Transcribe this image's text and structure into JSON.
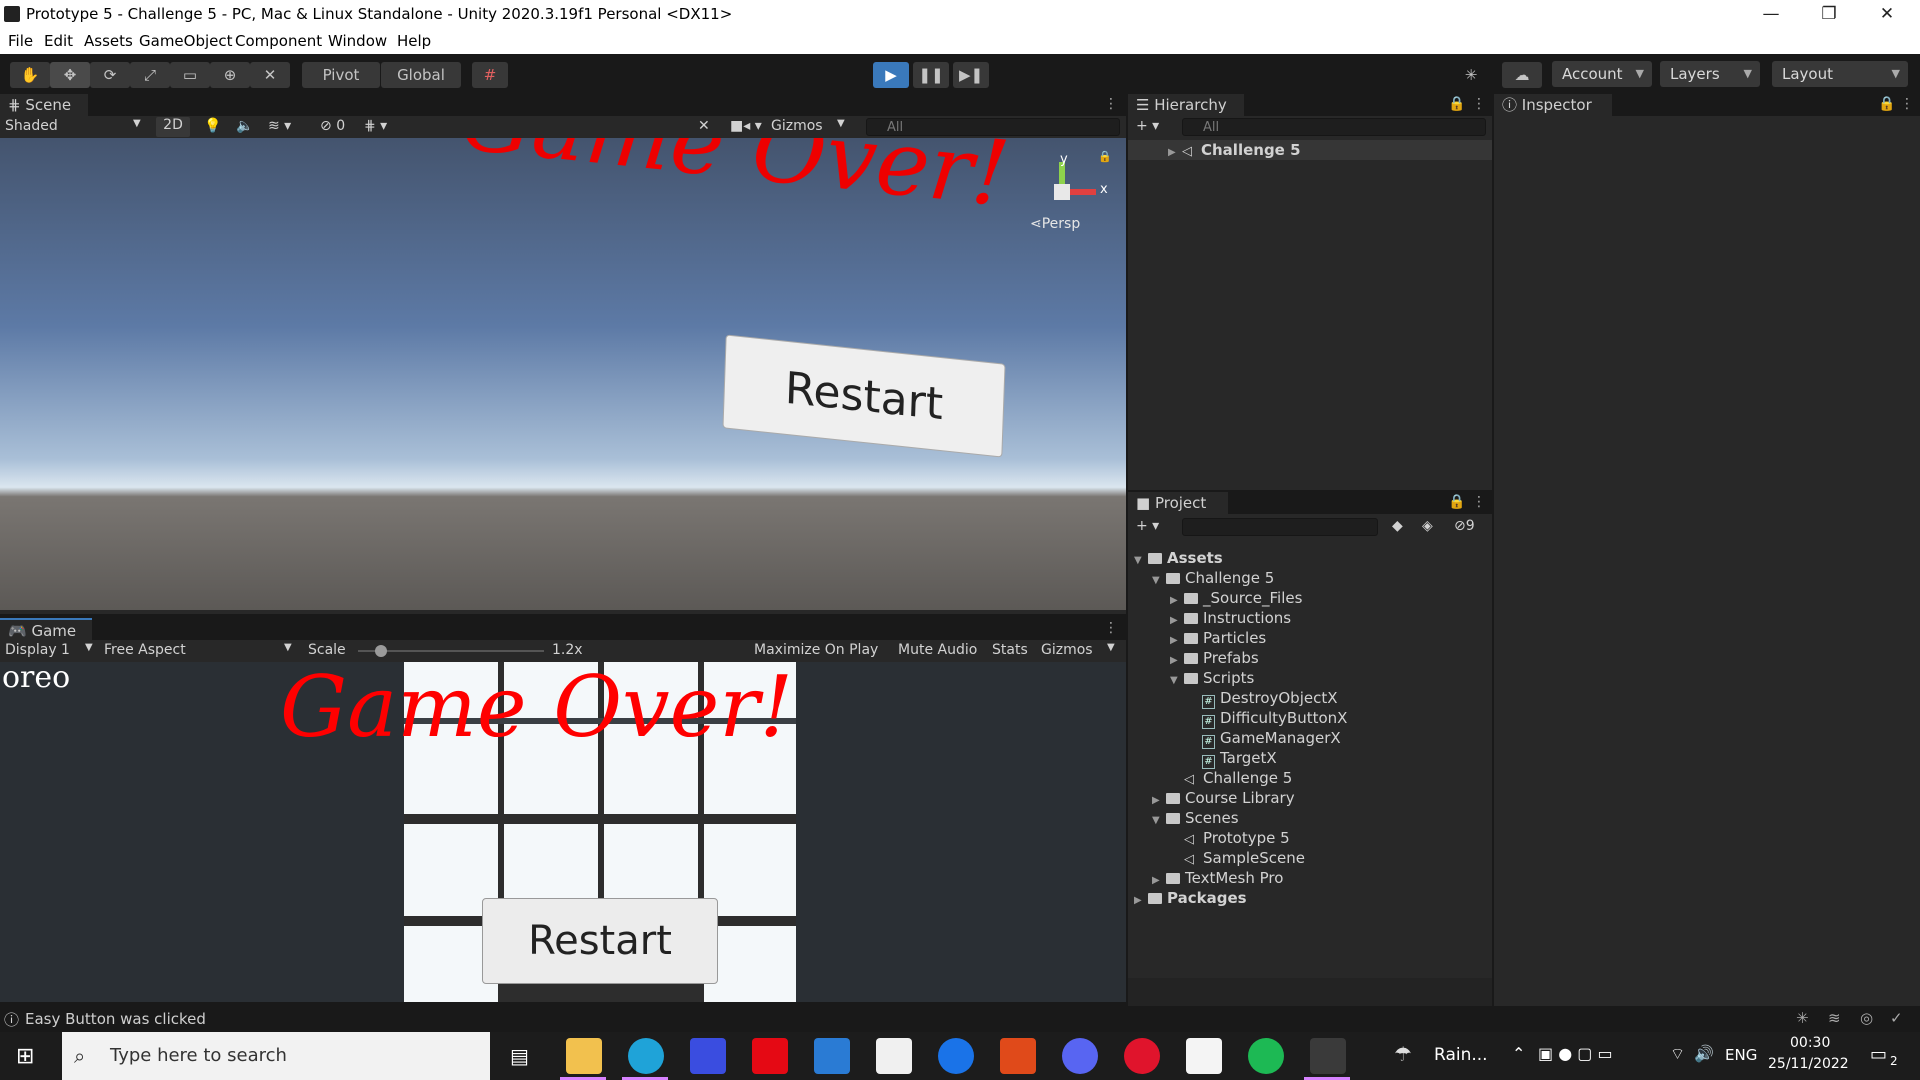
{
  "window": {
    "title": "Prototype 5 - Challenge 5 - PC, Mac & Linux Standalone - Unity 2020.3.19f1 Personal <DX11>",
    "min_glyph": "—",
    "max_glyph": "❐",
    "close_glyph": "✕"
  },
  "menu": [
    "File",
    "Edit",
    "Assets",
    "GameObject",
    "Component",
    "Window",
    "Help"
  ],
  "toolbar": {
    "pivot": "Pivot",
    "global": "Global",
    "account": "Account",
    "layers": "Layers",
    "layout": "Layout"
  },
  "scene": {
    "tab": "Scene",
    "shading": "Shaded",
    "mode_2d": "2D",
    "hidden_count": "0",
    "gizmos": "Gizmos",
    "search_placeholder": "All",
    "persp": "Persp",
    "gizmo_y": "y",
    "gizmo_x": "x",
    "overlay_text": "Game Over!",
    "restart_label": "Restart"
  },
  "game": {
    "tab": "Game",
    "display": "Display 1",
    "aspect": "Free Aspect",
    "scale_label": "Scale",
    "scale_value": "1.2x",
    "scale_level": 0.1,
    "maximize": "Maximize On Play",
    "mute": "Mute Audio",
    "stats": "Stats",
    "gizmos": "Gizmos",
    "score_text": "oreo",
    "game_over_text": "Game Over!",
    "restart_label": "Restart"
  },
  "hierarchy": {
    "tab": "Hierarchy",
    "search_placeholder": "All",
    "root": "Challenge 5"
  },
  "project": {
    "tab": "Project",
    "hidden_count": "9",
    "tree": [
      {
        "label": "Assets",
        "depth": 0,
        "kind": "folder",
        "expanded": true,
        "bold": true
      },
      {
        "label": "Challenge 5",
        "depth": 1,
        "kind": "folder",
        "expanded": true
      },
      {
        "label": "_Source_Files",
        "depth": 2,
        "kind": "folder",
        "expanded": false
      },
      {
        "label": "Instructions",
        "depth": 2,
        "kind": "folder",
        "expanded": false
      },
      {
        "label": "Particles",
        "depth": 2,
        "kind": "folder",
        "expanded": false
      },
      {
        "label": "Prefabs",
        "depth": 2,
        "kind": "folder",
        "expanded": false
      },
      {
        "label": "Scripts",
        "depth": 2,
        "kind": "folder",
        "expanded": true
      },
      {
        "label": "DestroyObjectX",
        "depth": 3,
        "kind": "script"
      },
      {
        "label": "DifficultyButtonX",
        "depth": 3,
        "kind": "script"
      },
      {
        "label": "GameManagerX",
        "depth": 3,
        "kind": "script"
      },
      {
        "label": "TargetX",
        "depth": 3,
        "kind": "script"
      },
      {
        "label": "Challenge 5",
        "depth": 2,
        "kind": "scene"
      },
      {
        "label": "Course Library",
        "depth": 1,
        "kind": "folder",
        "expanded": false
      },
      {
        "label": "Scenes",
        "depth": 1,
        "kind": "folder",
        "expanded": true
      },
      {
        "label": "Prototype 5",
        "depth": 2,
        "kind": "scene"
      },
      {
        "label": "SampleScene",
        "depth": 2,
        "kind": "scene"
      },
      {
        "label": "TextMesh Pro",
        "depth": 1,
        "kind": "folder",
        "expanded": false
      },
      {
        "label": "Packages",
        "depth": 0,
        "kind": "folder",
        "expanded": false,
        "bold": true
      }
    ]
  },
  "inspector": {
    "tab": "Inspector"
  },
  "status": {
    "message": "Easy Button was clicked"
  },
  "taskbar": {
    "search_placeholder": "Type here to search",
    "weather": "Rain...",
    "lang": "ENG",
    "time": "00:30",
    "date": "25/11/2022",
    "notifications": "2"
  },
  "colors": {
    "editor_bg": "#282828",
    "toolbar_bg": "#191919",
    "play_active": "#3a79bb",
    "game_over_red": "#ff0000",
    "taskbar_bg": "#1c1c1c"
  }
}
